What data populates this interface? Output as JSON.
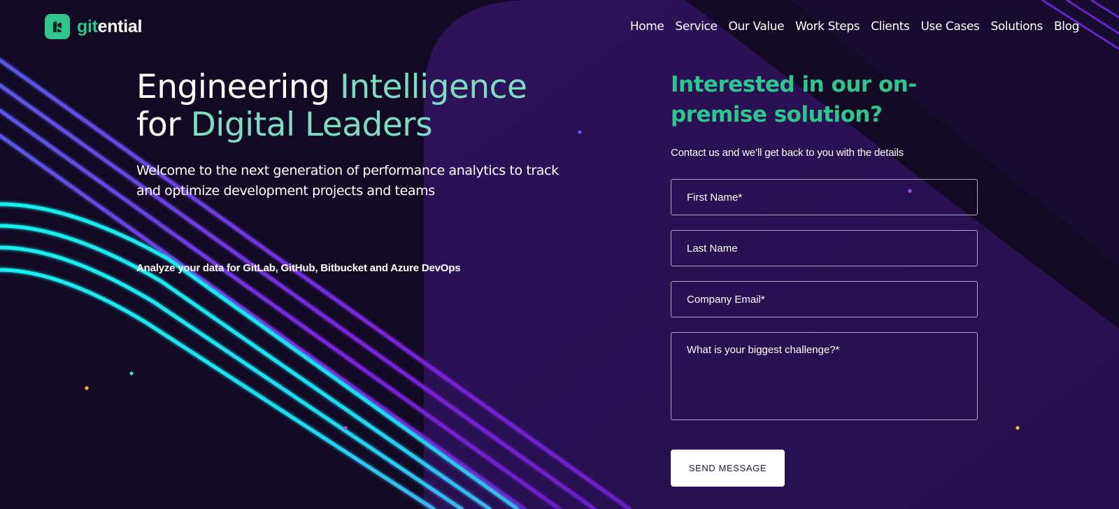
{
  "brand": {
    "logo_part1": "git",
    "logo_part2": "ential",
    "primary_color": "#2ec58f",
    "background_color": "#120a24"
  },
  "nav": {
    "items": [
      {
        "label": "Home"
      },
      {
        "label": "Service"
      },
      {
        "label": "Our Value"
      },
      {
        "label": "Work Steps"
      },
      {
        "label": "Clients"
      },
      {
        "label": "Use Cases"
      },
      {
        "label": "Solutions"
      },
      {
        "label": "Blog"
      }
    ]
  },
  "hero": {
    "title_part1": "Engineering ",
    "title_part2": "Intelligence",
    "title_part3": "for ",
    "title_part4": "Digital Leaders",
    "subtitle": "Welcome to the next generation of performance analytics to track and optimize development projects and teams",
    "platforms": "Analyze your data for GitLab, GitHub, Bitbucket and Azure DevOps"
  },
  "form": {
    "title": "Interested in our on-premise solution?",
    "lead": "Contact us and we’ll get back to you with the details",
    "first_name_placeholder": "First Name*",
    "last_name_placeholder": "Last Name",
    "email_placeholder": "Company Email*",
    "challenge_placeholder": "What is your biggest challenge?*",
    "submit_label": "SEND MESSAGE"
  }
}
